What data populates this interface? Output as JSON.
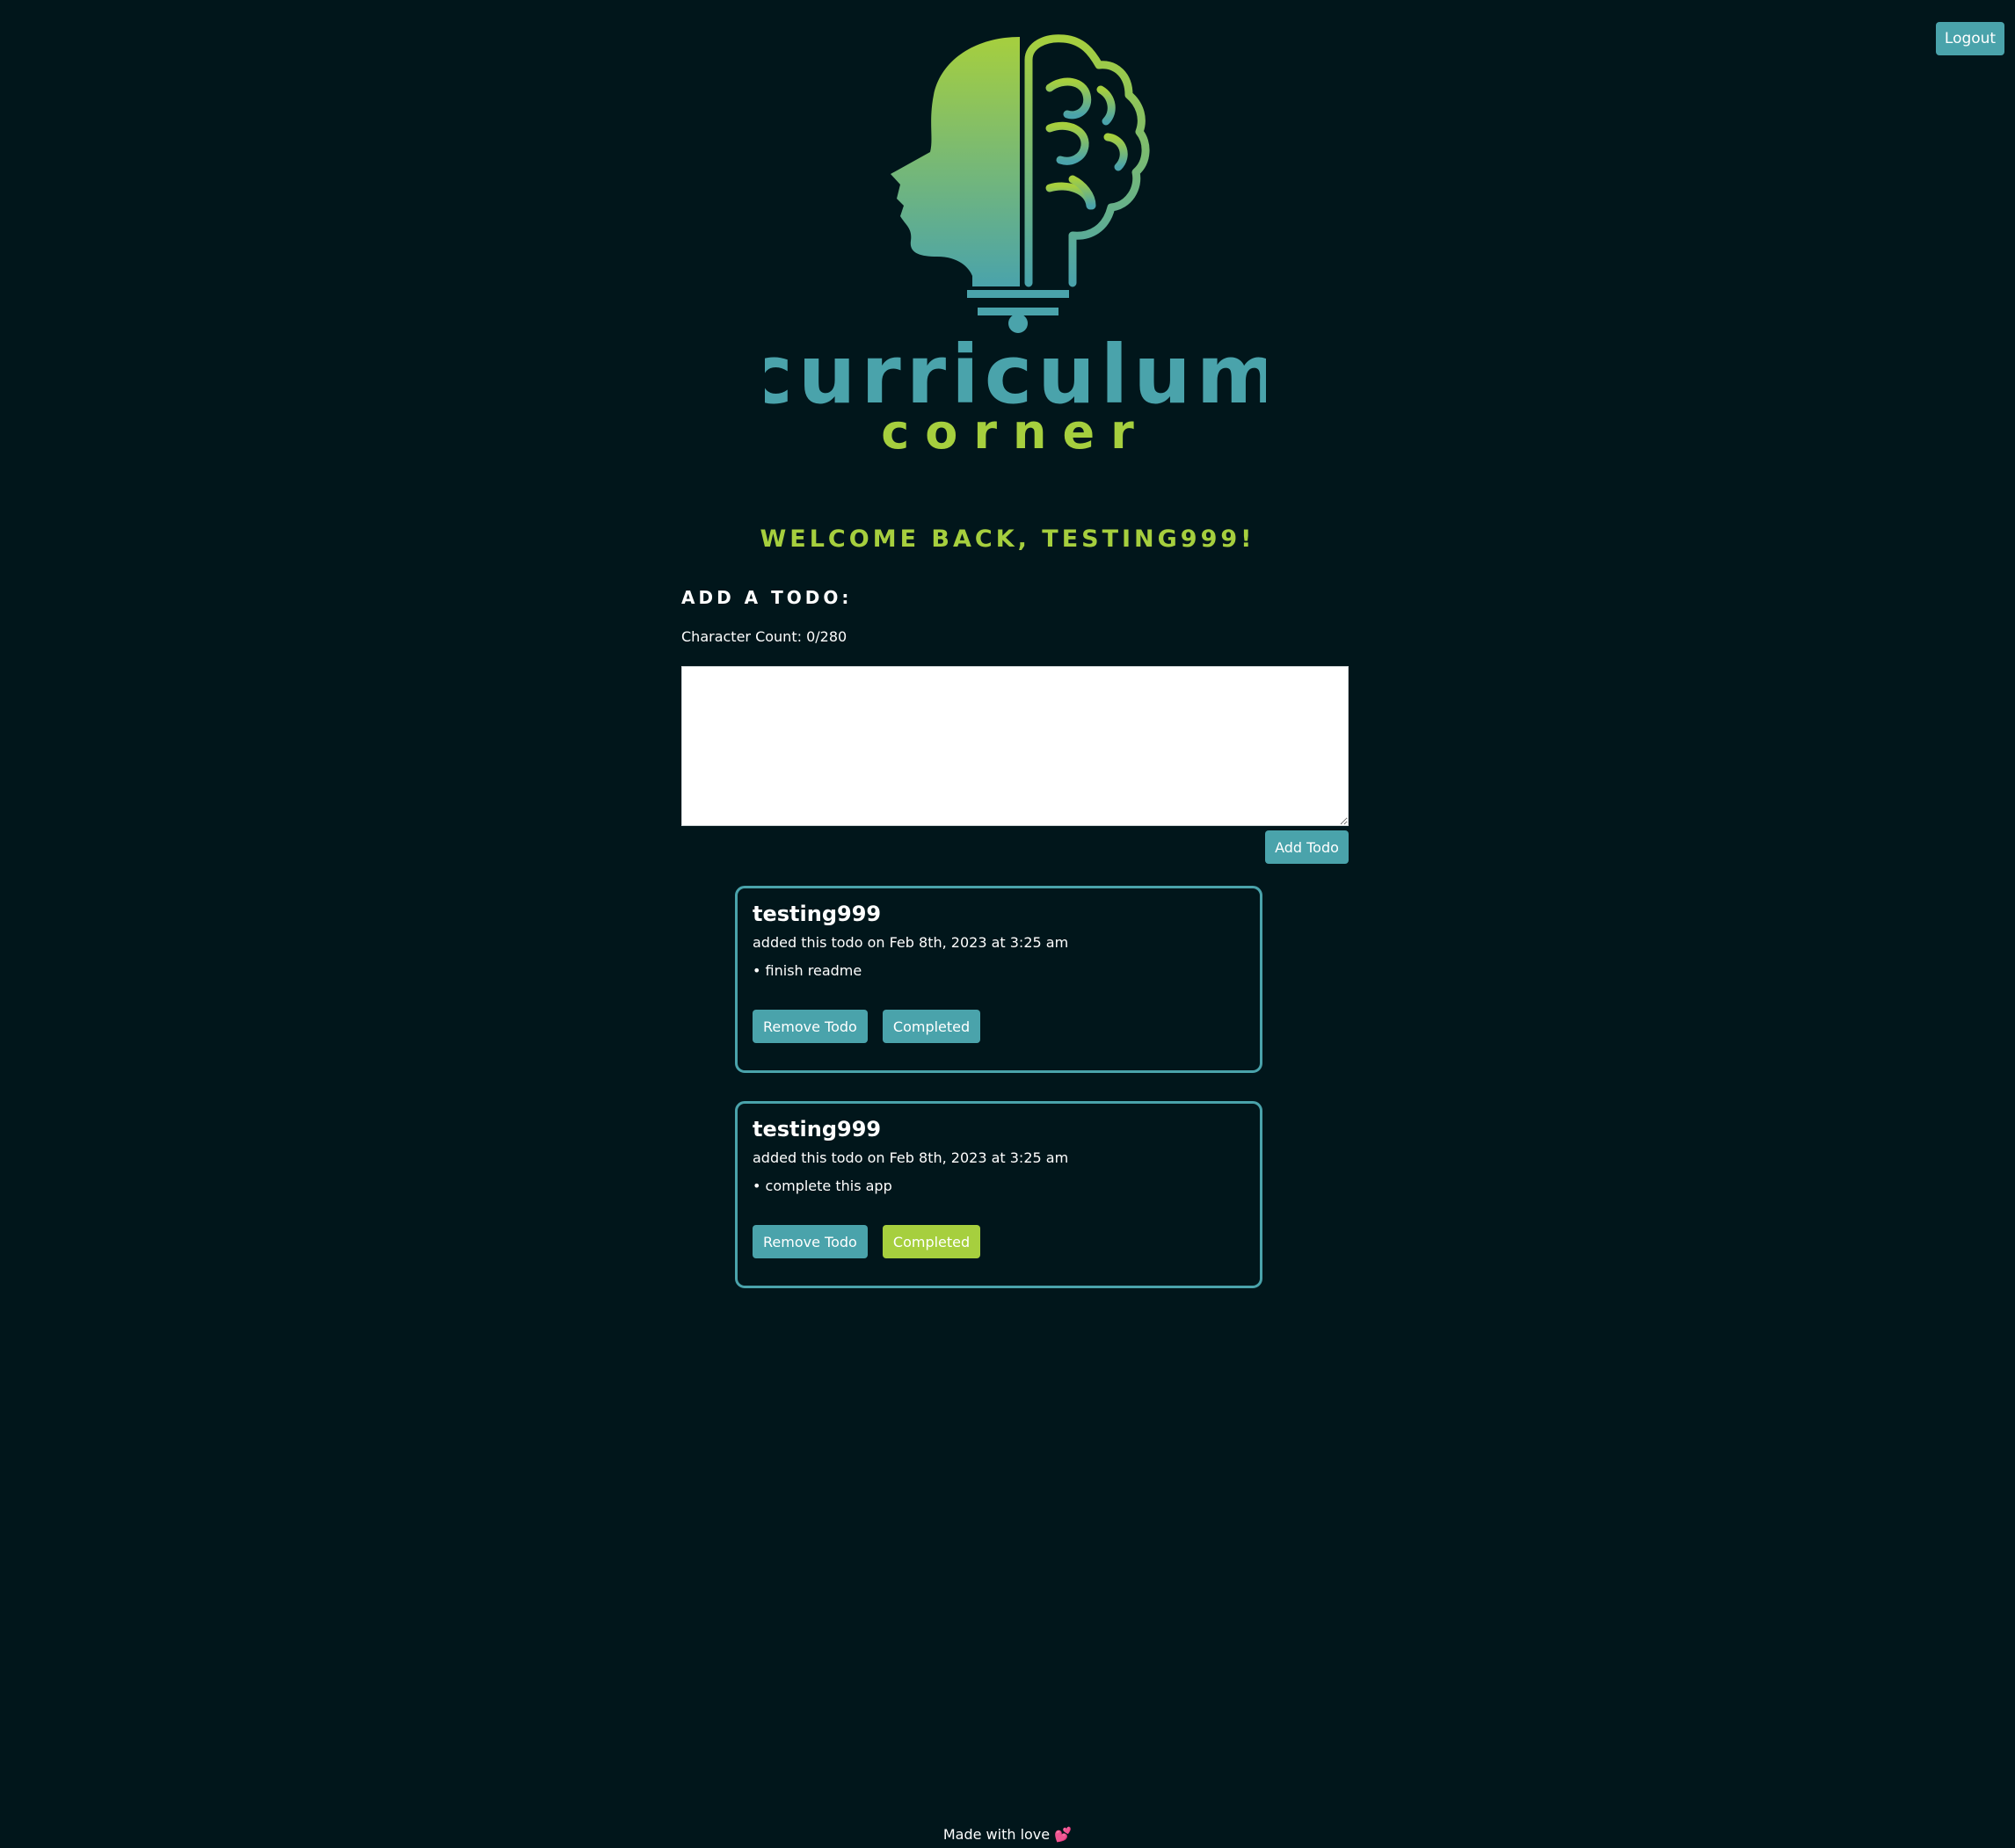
{
  "header": {
    "logout_label": "Logout"
  },
  "logo": {
    "word_1": "curriculum",
    "word_2": "corner"
  },
  "welcome": {
    "text": "Welcome back, testing999!"
  },
  "add_todo": {
    "heading": "Add a todo:",
    "char_count_label": "Character Count:",
    "char_count_value": "0/280",
    "textarea_value": "",
    "button_label": "Add Todo"
  },
  "todos": [
    {
      "author": "testing999",
      "added_line": "added this todo on Feb 8th, 2023 at 3:25 am",
      "text": "• finish readme",
      "remove_label": "Remove Todo",
      "complete_label": "Completed",
      "completed": false
    },
    {
      "author": "testing999",
      "added_line": "added this todo on Feb 8th, 2023 at 3:25 am",
      "text": "• complete this app",
      "remove_label": "Remove Todo",
      "complete_label": "Completed",
      "completed": true
    }
  ],
  "footer": {
    "text": "Made with love",
    "heart": "💕"
  },
  "colors": {
    "background": "#01161b",
    "teal": "#4aa3ab",
    "green": "#a6cf3e",
    "white": "#ffffff"
  }
}
